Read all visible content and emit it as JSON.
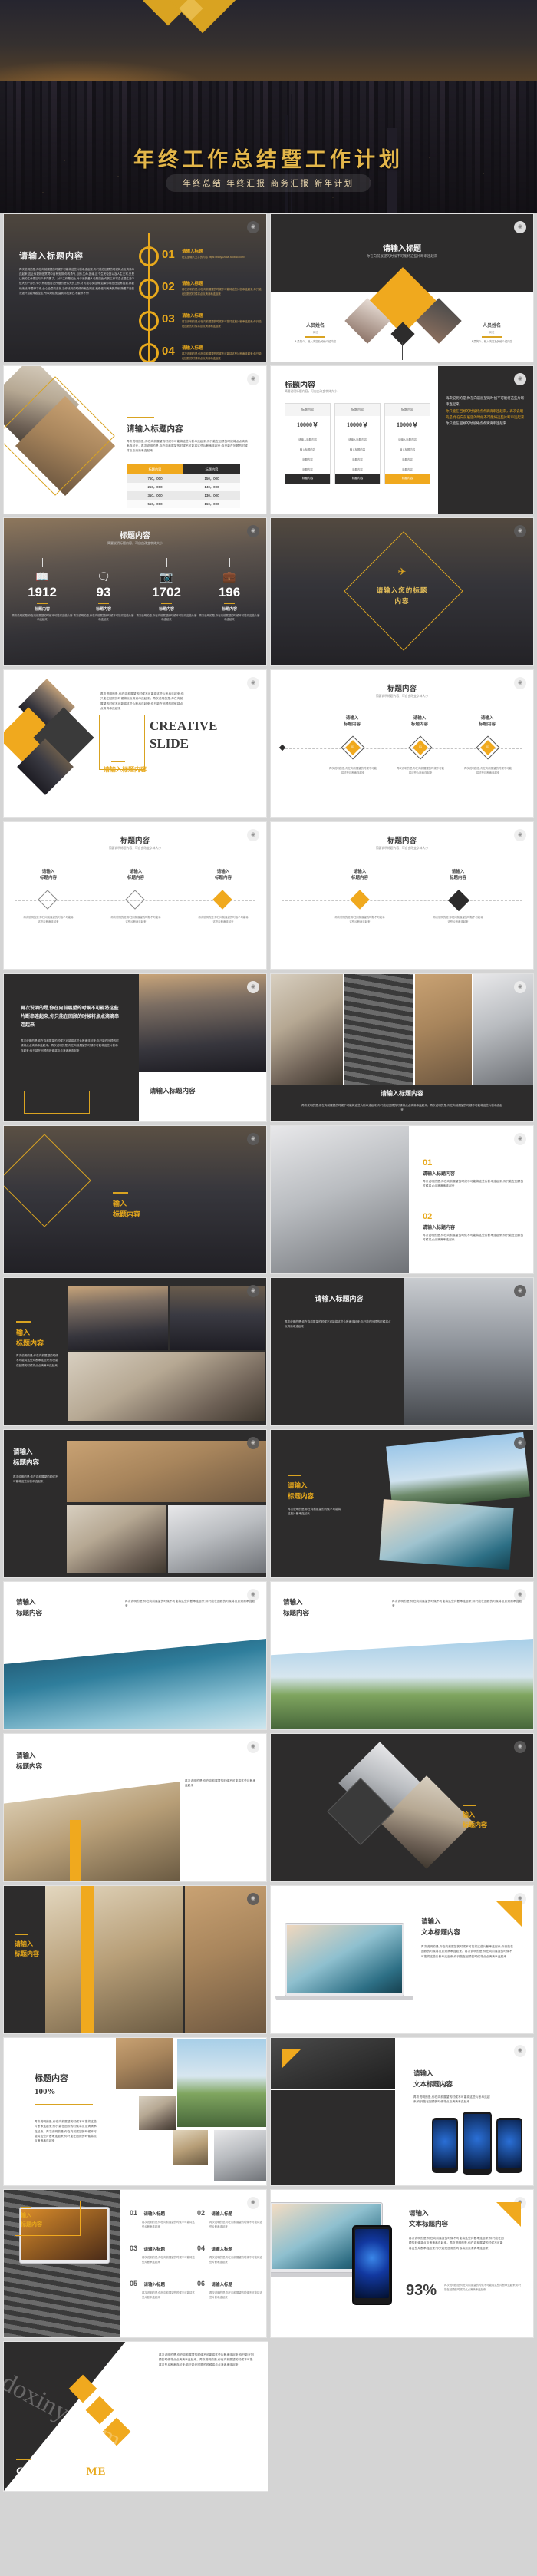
{
  "cover": {
    "title": "年终工作总结暨工作计划",
    "subtitle": "年终总结  年终汇报  商务汇报  新年计划"
  },
  "common": {
    "heading_long": "请输入标题内容",
    "heading_short": "请输入标题",
    "heading_content": "标题内容",
    "subheading": "简要说明标题内容，可自由改变字体大小",
    "sub_small": "你在向前展望的时候不可能将这些片断串连起来",
    "input_title": "输入标题内容",
    "input_word": "输入",
    "text_title_content": "文本标题内容",
    "please_input": "请输入",
    "body_short": "再次说明的是,你在向前展望的时候不可能将这些片断串连起来;你只能在回顾的时候将点点滴滴串连起来",
    "body_mid": "再次说明的是,你在向前展望的时候不可能将这些片断串连起来;你只能在回顾的时候将点点滴滴串连起来，再次说明的是,你在向前展望的时候不可能将这些片断串连起来",
    "body_long": "再次说明的是,你在向前展望的时候不可能将这些片断串连起来;你只能在回顾的时候将点点滴滴串连起来。再次说明的是,你在向前展望的时候不可能将这些片断串连起来;你只能在回顾的时候将点点滴滴串连起来。",
    "logo_icon": "panda-logo-icon"
  },
  "slide_timeline": {
    "title": "请输入标题内容",
    "paragraph": "再次说明的是,你在向前展望的时候不可能将这些片断串连起来;你只能在回顾的时候将点点滴滴串连起来,这让你更相信冥冥中自有安排:你的勇气,目的,生命,因缘,这个生死轮回以及人生无常,只是让我的生命更加与众不同罢了。对于工作是如此,对于我的爱人也是如此:你的工作将会占据生活中很大的一部分,你只有相信自己所做的是伟大的工作,才可能心安自得,如果你现在还没有找到,那要继续找,不要停下来,全心全意的去找,当你找到的时候你就会知道,就像任何美满的关系,随着岁月的流逝只会越来越坚定,所以继续找,直到你找到它,不要停下来!",
    "items": [
      {
        "num": "01",
        "title": "请输入标题",
        "text": "在这里输入文字的内容 https://baoyuzucai.taobao.com/"
      },
      {
        "num": "02",
        "title": "请输入标题",
        "text": "再次说明的是,你在向前展望的时候不可能将这些片断串连起来;你只能在回顾的时候将点点滴滴串连起来"
      },
      {
        "num": "03",
        "title": "请输入标题",
        "text": "再次说明的是,你在向前展望的时候不可能将这些片断串连起来;你只能在回顾的时候将点点滴滴串连起来"
      },
      {
        "num": "04",
        "title": "请输入标题",
        "text": "再次说明的是,你在向前展望的时候不可能将这些片断串连起来;你只能在回顾的时候将点点滴滴串连起来"
      }
    ]
  },
  "slide_team": {
    "title": "请输入标题",
    "subtitle": "你在向前展望的时候不可能将这些片断串连起来",
    "people": [
      {
        "name": "人员姓名",
        "role": "岗位",
        "desc": "人员简介，输入内容及其他介绍内容"
      },
      {
        "name": "人员姓名",
        "role": "岗位",
        "desc": "人员简介，输入内容及其他介绍内容"
      }
    ]
  },
  "slide_table": {
    "title": "请输入标题内容",
    "paragraph": "再次说明的是,你在向前展望的时候不可能将这些片断串连起来;你只能在回顾的时候将点点滴滴串连起来，再次说明的是,你在向前展望的时候不可能将这些片断串连起来;你只能在回顾的时候将点点滴滴串连起来",
    "headers": [
      "标题内容",
      "标题内容"
    ],
    "rows": [
      [
        "750，000",
        "150，000"
      ],
      [
        "250，000",
        "140，000"
      ],
      [
        "350，000",
        "130，000"
      ],
      [
        "550，000",
        "160，000"
      ]
    ]
  },
  "slide_pricing": {
    "title": "标题内容",
    "subtitle": "简要说明标题内容，可自由改变字体大小",
    "columns": [
      {
        "header": "标题内容",
        "price": "10000￥",
        "rows": [
          "请输入标题内容",
          "输入标题内容",
          "标题内容",
          "标题内容"
        ],
        "cta": "标题内容",
        "highlight": false
      },
      {
        "header": "标题内容",
        "price": "10000￥",
        "rows": [
          "请输入标题内容",
          "输入标题内容",
          "标题内容",
          "标题内容"
        ],
        "cta": "标题内容",
        "highlight": false
      },
      {
        "header": "标题内容",
        "price": "10000￥",
        "rows": [
          "请输入标题内容",
          "输入标题内容",
          "标题内容",
          "标题内容"
        ],
        "cta": "标题内容",
        "highlight": true
      }
    ],
    "side_text_1": "再次说明的是,你在向前展望的时候不可能将这些片断串连起来",
    "side_text_2": "你只能在回顾的时候将点点滴滴串连起来，再次说明的是,你在向前展望的时候不可能将这些片断串连起来",
    "side_text_3": "你只能在回顾的时候将点点滴滴串连起来"
  },
  "slide_stats": {
    "title": "标题内容",
    "subtitle": "简要说明标题内容，可自由改变字体大小",
    "items": [
      {
        "icon": "book-icon",
        "value": "1912",
        "label": "标题内容",
        "desc": "再次说明的是,你在向前展望的时候不可能将这些片断串连起来"
      },
      {
        "icon": "chat-icon",
        "value": "93",
        "label": "标题内容",
        "desc": "再次说明的是,你在向前展望的时候不可能将这些片断串连起来"
      },
      {
        "icon": "camera-icon",
        "value": "1702",
        "label": "标题内容",
        "desc": "再次说明的是,你在向前展望的时候不可能将这些片断串连起来"
      },
      {
        "icon": "briefcase-icon",
        "value": "196",
        "label": "标题内容",
        "desc": "再次说明的是,你在向前展望的时候不可能将这些片断串连起来"
      }
    ]
  },
  "slide_section": {
    "title_line1": "请输入您的标题",
    "title_line2": "内容",
    "icon": "plane-icon"
  },
  "slide_creative": {
    "label_en": "CREATIVE SLIDE",
    "title_cn": "请输入标题内容",
    "paragraph": "再次说明的是,你在向前展望的时候不可能将这些片断串连起来;你只能在回顾的时候将点点滴滴串连起来，再次说明的是,你在向前展望的时候不可能将这些片断串连起来;你只能在回顾的时候将点点滴滴串连起来"
  },
  "slide_milestones": {
    "title": "标题内容",
    "subtitle": "简要说明标题内容，可自由改变字体大小",
    "nodes": [
      {
        "num": "01",
        "title": "请输入\n标题内容",
        "desc": "再次说明的是,你在向前展望的时候不可能将这些片断串连起来"
      },
      {
        "num": "01",
        "title": "请输入\n标题内容",
        "desc": "再次说明的是,你在向前展望的时候不可能将这些片断串连起来"
      },
      {
        "num": "01",
        "title": "请输入\n标题内容",
        "desc": "再次说明的是,你在向前展望的时候不可能将这些片断串连起来"
      }
    ]
  },
  "slide_four_a": {
    "title": "标题内容",
    "subtitle": "简要说明标题内容，可自由改变字体大小",
    "cards": [
      {
        "title": "请输入\n标题内容",
        "desc": "再次说明的是,你在向前展望的时候不可能将这些片断串连起来"
      },
      {
        "title": "请输入\n标题内容",
        "desc": "再次说明的是,你在向前展望的时候不可能将这些片断串连起来"
      },
      {
        "title": "请输入\n标题内容",
        "desc": "再次说明的是,你在向前展望的时候不可能将这些片断串连起来"
      }
    ]
  },
  "slide_four_b": {
    "title": "标题内容",
    "subtitle": "简要说明标题内容，可自由改变字体大小",
    "cards": [
      {
        "title": "请输入\n标题内容",
        "desc": "再次说明的是,你在向前展望的时候不可能将这些片断串连起来"
      },
      {
        "title": "请输入\n标题内容",
        "desc": "再次说明的是,你在向前展望的时候不可能将这些片断串连起来"
      }
    ]
  },
  "slide_city_text": {
    "headline": "再次说明的是,你在向前展望的时候不可能将这些片断串连起来;你只能在回顾的时候将点点滴滴串连起来",
    "paragraph": "再次说明的是,你在向前展望的时候不可能将这些片断串连起来;你只能在回顾的时候将点点滴滴串连起来。再次说明的是,你在向前展望的时候不可能将这些片断串连起来;你只能在回顾的时候将点点滴滴串连起来",
    "caption": "请输入标题内容"
  },
  "slide_laptops": {
    "caption": "请输入标题内容",
    "paragraph": "再次说明的是,你在向前展望的时候不可能将这些片断串连起来;你只能在回顾的时候将点点滴滴串连起来，再次说明的是,你在向前展望的时候不可能将这些片断串连起来"
  },
  "slide_frame_city": {
    "title_line1": "输入",
    "title_line2": "标题内容"
  },
  "slide_numbered_two": {
    "items": [
      {
        "num": "01",
        "title": "请输入标题内容",
        "desc": "再次说明的是,你在向前展望的时候不可能将这些片断串连起来;你只能在回顾的时候将点点滴滴串连起来"
      },
      {
        "num": "02",
        "title": "请输入标题内容",
        "desc": "再次说明的是,你在向前展望的时候不可能将这些片断串连起来;你只能在回顾的时候将点点滴滴串连起来"
      }
    ]
  },
  "slide_collage_a": {
    "title_line1": "输入",
    "title_line2": "标题内容",
    "paragraph": "再次说明的是,你在向前展望的时候不可能将这些片断串连起来;你只能在回顾的时候将点点滴滴串连起来"
  },
  "slide_collage_b": {
    "title": "请输入标题内容",
    "paragraph": "再次说明的是,你在向前展望的时候不可能将这些片断串连起来;你只能在回顾的时候将点点滴滴串连起来"
  },
  "slide_collage_c": {
    "title_line1": "请输入",
    "title_line2": "标题内容",
    "paragraph": "再次说明的是,你在向前展望的时候不可能将这些片断串连起来"
  },
  "slide_collage_d": {
    "title_line1": "请输入",
    "title_line2": "标题内容",
    "paragraph": "再次说明的是,你在向前展望的时候不可能将这些片断串连起来"
  },
  "slide_sea": {
    "title_line1": "请输入",
    "title_line2": "标题内容",
    "paragraph": "再次说明的是,你在向前展望的时候不可能将这些片断串连起来;你只能在回顾的时候将点点滴滴串连起来"
  },
  "slide_grass": {
    "title_line1": "请输入",
    "title_line2": "标题内容",
    "paragraph": "再次说明的是,你在向前展望的时候不可能将这些片断串连起来;你只能在回顾的时候将点点滴滴串连起来"
  },
  "slide_book": {
    "title_line1": "请输入",
    "title_line2": "标题内容",
    "paragraph": "再次说明的是,你在向前展望的时候不可能将这些片断串连起来"
  },
  "slide_diamond_photo": {
    "title_line1": "输入",
    "title_line2": "标题内容"
  },
  "slide_mac_wave": {
    "title_line1": "请输入",
    "title_line2": "文本标题内容",
    "paragraph": "再次说明的是,你在向前展望的时候不可能将这些片断串连起来;你只能在回顾的时候将点点滴滴串连起来。再次说明的是,你在向前展望的时候不可能将这些片断串连起来;你只能在回顾的时候将点点滴滴串连起来"
  },
  "slide_percent": {
    "title": "标题内容",
    "value": "100%",
    "paragraph": "再次说明的是,你在向前展望的时候不可能将这些片断串连起来;你只能在回顾的时候将点点滴滴串连起来。再次说明的是,你在向前展望的时候不可能将这些片断串连起来;你只能在回顾的时候将点点滴滴串连起来"
  },
  "slide_phones": {
    "title_line1": "请输入",
    "title_line2": "文本标题内容",
    "paragraph": "再次说明的是,你在向前展望的时候不可能将这些片断串连起来;你只能在回顾的时候将点点滴滴串连起来"
  },
  "slide_six": {
    "title_line1": "输入",
    "title_line2": "标题内容",
    "items": [
      {
        "num": "01",
        "title": "请输入标题",
        "desc": "再次说明的是,你在向前展望的时候不可能将这些片断串连起来"
      },
      {
        "num": "02",
        "title": "请输入标题",
        "desc": "再次说明的是,你在向前展望的时候不可能将这些片断串连起来"
      },
      {
        "num": "03",
        "title": "请输入标题",
        "desc": "再次说明的是,你在向前展望的时候不可能将这些片断串连起来"
      },
      {
        "num": "04",
        "title": "请输入标题",
        "desc": "再次说明的是,你在向前展望的时候不可能将这些片断串连起来"
      },
      {
        "num": "05",
        "title": "请输入标题",
        "desc": "再次说明的是,你在向前展望的时候不可能将这些片断串连起来"
      },
      {
        "num": "06",
        "title": "请输入标题",
        "desc": "再次说明的是,你在向前展望的时候不可能将这些片断串连起来"
      }
    ]
  },
  "slide_iphone_93": {
    "title_line1": "请输入",
    "title_line2": "文本标题内容",
    "paragraph": "再次说明的是,你在向前展望的时候不可能将这些片断串连起来;你只能在回顾的时候将点点滴滴串连起来。再次说明的是,你在向前展望的时候不可能将这些片断串连起来;你只能在回顾的时候将点点滴滴串连起来",
    "stat": "93%",
    "stat_desc": "再次说明的是,你在向前展望的时候不可能将这些片断串连起来;你只能在回顾的时候将点点滴滴串连起来"
  },
  "slide_contact": {
    "contact_label": "CONTACT",
    "contact_accent": "ME",
    "watermark": "doxinyi.com",
    "paragraph": "再次说明的是,你在向前展望的时候不可能将这些片断串连起来;你只能在回顾的时候将点点滴滴串连起来。再次说明的是,你在向前展望的时候不可能将这些片断串连起来;你只能在回顾的时候将点点滴滴串连起来"
  },
  "colors": {
    "gold": "#f0a91e",
    "gold_dark": "#d9a321",
    "dark": "#2d2c2c",
    "title_gold": "#e3b64a"
  }
}
